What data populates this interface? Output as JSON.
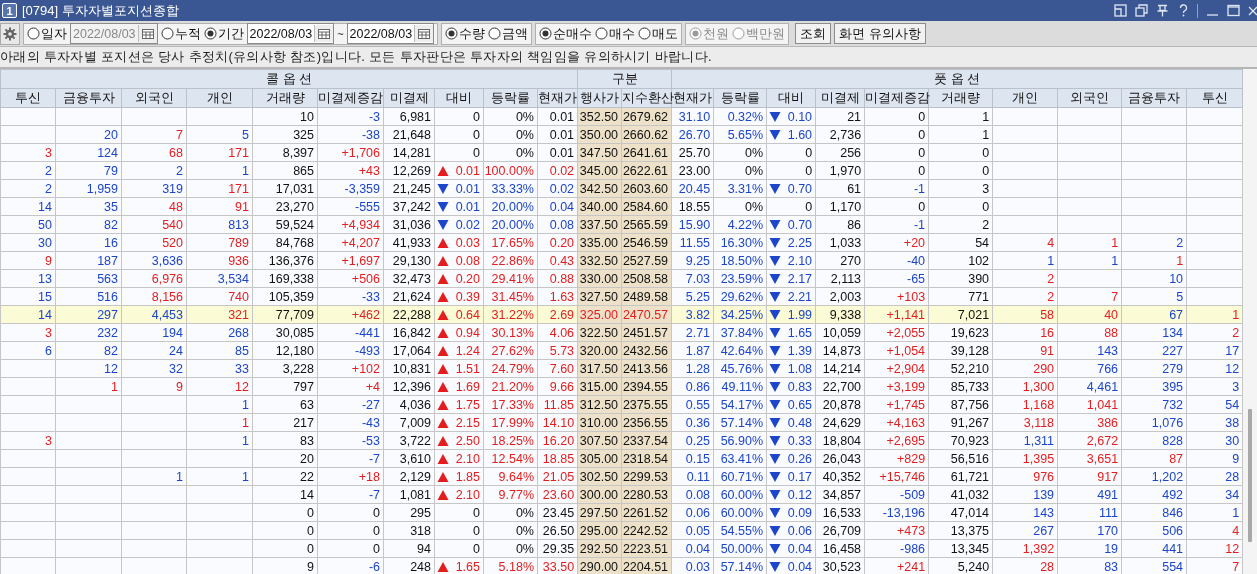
{
  "window": {
    "badge": "1",
    "title": "[0794] 투자자별포지션종합"
  },
  "toolbar": {
    "option_groups": [
      {
        "disabled": false,
        "items": [
          {
            "kind": "radio",
            "label": "일자",
            "selected": false
          },
          {
            "kind": "date",
            "value": "2022/08/03",
            "disabled": true
          },
          {
            "kind": "radio",
            "label": "누적",
            "selected": false
          },
          {
            "kind": "radio",
            "label": "기간",
            "selected": true
          },
          {
            "kind": "date",
            "value": "2022/08/03",
            "disabled": false
          },
          {
            "kind": "text",
            "label": "~"
          },
          {
            "kind": "date",
            "value": "2022/08/03",
            "disabled": false
          }
        ]
      },
      {
        "disabled": false,
        "items": [
          {
            "kind": "radio",
            "label": "수량",
            "selected": true
          },
          {
            "kind": "radio",
            "label": "금액",
            "selected": false
          }
        ]
      },
      {
        "disabled": false,
        "items": [
          {
            "kind": "radio",
            "label": "순매수",
            "selected": true
          },
          {
            "kind": "radio",
            "label": "매수",
            "selected": false
          },
          {
            "kind": "radio",
            "label": "매도",
            "selected": false
          }
        ]
      },
      {
        "disabled": true,
        "items": [
          {
            "kind": "radio",
            "label": "천원",
            "selected": true
          },
          {
            "kind": "radio",
            "label": "백만원",
            "selected": false
          }
        ]
      }
    ],
    "buttons": [
      "조회",
      "화면 유의사항"
    ]
  },
  "notice": "아래의 투자자별 포지션은 당사 추정치(유의사항 참조)입니다. 모든 투자판단은 투자자의 책임임을 유의하시기 바랍니다.",
  "table": {
    "column_groups": [
      {
        "kind": "call",
        "label": "콜 옵 션",
        "columns": [
          "투신",
          "금융투자",
          "외국인",
          "개인",
          "거래량",
          "미결제증감",
          "미결제",
          "대비",
          "등락률",
          "현재가"
        ]
      },
      {
        "kind": "strike",
        "label": "구분",
        "columns": [
          "행사가",
          "지수환산"
        ]
      },
      {
        "kind": "put",
        "label": "풋 옵 션",
        "columns": [
          "현재가",
          "등락률",
          "대비",
          "미결제",
          "미결제증감",
          "거래량",
          "개인",
          "외국인",
          "금융투자",
          "투신"
        ]
      }
    ],
    "rows": [
      {
        "highlighted": false,
        "cells": [
          null,
          null,
          null,
          null,
          "10",
          {
            "text": "-3",
            "color": "#1c45c9"
          },
          "6,981",
          "0",
          "0%",
          "0.01",
          "352.50",
          "2679.62",
          {
            "text": "31.10",
            "color": "#1c45c9"
          },
          {
            "text": "0.32%",
            "color": "#1c45c9"
          },
          {
            "text": "0.10",
            "color": "#1c45c9",
            "rising": false
          },
          "21",
          "0",
          "1",
          null,
          null,
          null,
          null
        ]
      },
      {
        "highlighted": false,
        "cells": [
          null,
          {
            "text": "20",
            "color": "#1c45c9"
          },
          {
            "text": "7",
            "color": "#e41e1e"
          },
          {
            "text": "5",
            "color": "#1c45c9"
          },
          "325",
          {
            "text": "-38",
            "color": "#1c45c9"
          },
          "21,648",
          "0",
          "0%",
          "0.01",
          "350.00",
          "2660.62",
          {
            "text": "26.70",
            "color": "#1c45c9"
          },
          {
            "text": "5.65%",
            "color": "#1c45c9"
          },
          {
            "text": "1.60",
            "color": "#1c45c9",
            "rising": false
          },
          "2,736",
          "0",
          "1",
          null,
          null,
          null,
          null
        ]
      },
      {
        "highlighted": false,
        "cells": [
          {
            "text": "3",
            "color": "#e41e1e"
          },
          {
            "text": "124",
            "color": "#1c45c9"
          },
          {
            "text": "68",
            "color": "#e41e1e"
          },
          {
            "text": "171",
            "color": "#e41e1e"
          },
          "8,397",
          {
            "text": "+1,706",
            "color": "#e41e1e"
          },
          "14,281",
          "0",
          "0%",
          "0.01",
          "347.50",
          "2641.61",
          "25.70",
          "0%",
          "0",
          "256",
          "0",
          "0",
          null,
          null,
          null,
          null
        ]
      },
      {
        "highlighted": false,
        "cells": [
          {
            "text": "2",
            "color": "#1c45c9"
          },
          {
            "text": "79",
            "color": "#1c45c9"
          },
          {
            "text": "2",
            "color": "#1c45c9"
          },
          {
            "text": "1",
            "color": "#1c45c9"
          },
          "865",
          {
            "text": "+43",
            "color": "#e41e1e"
          },
          "12,269",
          {
            "text": "0.01",
            "color": "#e41e1e",
            "rising": true
          },
          {
            "text": "100.00%",
            "color": "#e41e1e"
          },
          {
            "text": "0.02",
            "color": "#e41e1e"
          },
          "345.00",
          "2622.61",
          "23.00",
          "0%",
          "0",
          "1,970",
          "0",
          "0",
          null,
          null,
          null,
          null
        ]
      },
      {
        "highlighted": false,
        "cells": [
          {
            "text": "2",
            "color": "#1c45c9"
          },
          {
            "text": "1,959",
            "color": "#1c45c9"
          },
          {
            "text": "319",
            "color": "#1c45c9"
          },
          {
            "text": "171",
            "color": "#e41e1e"
          },
          "17,031",
          {
            "text": "-3,359",
            "color": "#1c45c9"
          },
          "21,245",
          {
            "text": "0.01",
            "color": "#1c45c9",
            "rising": false
          },
          {
            "text": "33.33%",
            "color": "#1c45c9"
          },
          {
            "text": "0.02",
            "color": "#1c45c9"
          },
          "342.50",
          "2603.60",
          {
            "text": "20.45",
            "color": "#1c45c9"
          },
          {
            "text": "3.31%",
            "color": "#1c45c9"
          },
          {
            "text": "0.70",
            "color": "#1c45c9",
            "rising": false
          },
          "61",
          {
            "text": "-1",
            "color": "#1c45c9"
          },
          "3",
          null,
          null,
          null,
          null
        ]
      },
      {
        "highlighted": false,
        "cells": [
          {
            "text": "14",
            "color": "#1c45c9"
          },
          {
            "text": "35",
            "color": "#1c45c9"
          },
          {
            "text": "48",
            "color": "#e41e1e"
          },
          {
            "text": "91",
            "color": "#e41e1e"
          },
          "23,270",
          {
            "text": "-555",
            "color": "#1c45c9"
          },
          "37,242",
          {
            "text": "0.01",
            "color": "#1c45c9",
            "rising": false
          },
          {
            "text": "20.00%",
            "color": "#1c45c9"
          },
          {
            "text": "0.04",
            "color": "#1c45c9"
          },
          "340.00",
          "2584.60",
          "18.55",
          "0%",
          "0",
          "1,170",
          "0",
          "0",
          null,
          null,
          null,
          null
        ]
      },
      {
        "highlighted": false,
        "cells": [
          {
            "text": "50",
            "color": "#1c45c9"
          },
          {
            "text": "82",
            "color": "#1c45c9"
          },
          {
            "text": "540",
            "color": "#e41e1e"
          },
          {
            "text": "813",
            "color": "#1c45c9"
          },
          "59,524",
          {
            "text": "+4,934",
            "color": "#e41e1e"
          },
          "31,036",
          {
            "text": "0.02",
            "color": "#1c45c9",
            "rising": false
          },
          {
            "text": "20.00%",
            "color": "#1c45c9"
          },
          {
            "text": "0.08",
            "color": "#1c45c9"
          },
          "337.50",
          "2565.59",
          {
            "text": "15.90",
            "color": "#1c45c9"
          },
          {
            "text": "4.22%",
            "color": "#1c45c9"
          },
          {
            "text": "0.70",
            "color": "#1c45c9",
            "rising": false
          },
          "86",
          {
            "text": "-1",
            "color": "#1c45c9"
          },
          "2",
          null,
          null,
          null,
          null
        ]
      },
      {
        "highlighted": false,
        "cells": [
          {
            "text": "30",
            "color": "#1c45c9"
          },
          {
            "text": "16",
            "color": "#1c45c9"
          },
          {
            "text": "520",
            "color": "#e41e1e"
          },
          {
            "text": "789",
            "color": "#e41e1e"
          },
          "84,768",
          {
            "text": "+4,207",
            "color": "#e41e1e"
          },
          "41,933",
          {
            "text": "0.03",
            "color": "#e41e1e",
            "rising": true
          },
          {
            "text": "17.65%",
            "color": "#e41e1e"
          },
          {
            "text": "0.20",
            "color": "#e41e1e"
          },
          "335.00",
          "2546.59",
          {
            "text": "11.55",
            "color": "#1c45c9"
          },
          {
            "text": "16.30%",
            "color": "#1c45c9"
          },
          {
            "text": "2.25",
            "color": "#1c45c9",
            "rising": false
          },
          "1,033",
          {
            "text": "+20",
            "color": "#e41e1e"
          },
          "54",
          {
            "text": "4",
            "color": "#e41e1e"
          },
          {
            "text": "1",
            "color": "#e41e1e"
          },
          {
            "text": "2",
            "color": "#1c45c9"
          },
          null
        ]
      },
      {
        "highlighted": false,
        "cells": [
          {
            "text": "9",
            "color": "#e41e1e"
          },
          {
            "text": "187",
            "color": "#1c45c9"
          },
          {
            "text": "3,636",
            "color": "#1c45c9"
          },
          {
            "text": "936",
            "color": "#e41e1e"
          },
          "136,376",
          {
            "text": "+1,697",
            "color": "#e41e1e"
          },
          "29,130",
          {
            "text": "0.08",
            "color": "#e41e1e",
            "rising": true
          },
          {
            "text": "22.86%",
            "color": "#e41e1e"
          },
          {
            "text": "0.43",
            "color": "#e41e1e"
          },
          "332.50",
          "2527.59",
          {
            "text": "9.25",
            "color": "#1c45c9"
          },
          {
            "text": "18.50%",
            "color": "#1c45c9"
          },
          {
            "text": "2.10",
            "color": "#1c45c9",
            "rising": false
          },
          "270",
          {
            "text": "-40",
            "color": "#1c45c9"
          },
          "102",
          {
            "text": "1",
            "color": "#1c45c9"
          },
          {
            "text": "1",
            "color": "#1c45c9"
          },
          {
            "text": "1",
            "color": "#e41e1e"
          },
          null
        ]
      },
      {
        "highlighted": false,
        "cells": [
          {
            "text": "13",
            "color": "#1c45c9"
          },
          {
            "text": "563",
            "color": "#1c45c9"
          },
          {
            "text": "6,976",
            "color": "#e41e1e"
          },
          {
            "text": "3,534",
            "color": "#1c45c9"
          },
          "169,338",
          {
            "text": "+506",
            "color": "#e41e1e"
          },
          "32,473",
          {
            "text": "0.20",
            "color": "#e41e1e",
            "rising": true
          },
          {
            "text": "29.41%",
            "color": "#e41e1e"
          },
          {
            "text": "0.88",
            "color": "#e41e1e"
          },
          "330.00",
          "2508.58",
          {
            "text": "7.03",
            "color": "#1c45c9"
          },
          {
            "text": "23.59%",
            "color": "#1c45c9"
          },
          {
            "text": "2.17",
            "color": "#1c45c9",
            "rising": false
          },
          "2,113",
          {
            "text": "-65",
            "color": "#1c45c9"
          },
          "390",
          {
            "text": "2",
            "color": "#e41e1e"
          },
          null,
          {
            "text": "10",
            "color": "#1c45c9"
          },
          null
        ]
      },
      {
        "highlighted": false,
        "cells": [
          {
            "text": "15",
            "color": "#1c45c9"
          },
          {
            "text": "516",
            "color": "#1c45c9"
          },
          {
            "text": "8,156",
            "color": "#e41e1e"
          },
          {
            "text": "740",
            "color": "#e41e1e"
          },
          "105,359",
          {
            "text": "-33",
            "color": "#1c45c9"
          },
          "21,624",
          {
            "text": "0.39",
            "color": "#e41e1e",
            "rising": true
          },
          {
            "text": "31.45%",
            "color": "#e41e1e"
          },
          {
            "text": "1.63",
            "color": "#e41e1e"
          },
          "327.50",
          "2489.58",
          {
            "text": "5.25",
            "color": "#1c45c9"
          },
          {
            "text": "29.62%",
            "color": "#1c45c9"
          },
          {
            "text": "2.21",
            "color": "#1c45c9",
            "rising": false
          },
          "2,003",
          {
            "text": "+103",
            "color": "#e41e1e"
          },
          "771",
          {
            "text": "2",
            "color": "#e41e1e"
          },
          {
            "text": "7",
            "color": "#e41e1e"
          },
          {
            "text": "5",
            "color": "#1c45c9"
          },
          null
        ]
      },
      {
        "highlighted": true,
        "cells": [
          {
            "text": "14",
            "color": "#1c45c9"
          },
          {
            "text": "297",
            "color": "#1c45c9"
          },
          {
            "text": "4,453",
            "color": "#1c45c9"
          },
          {
            "text": "321",
            "color": "#e41e1e"
          },
          "77,709",
          {
            "text": "+462",
            "color": "#e41e1e"
          },
          "22,288",
          {
            "text": "0.64",
            "color": "#e41e1e",
            "rising": true
          },
          {
            "text": "31.22%",
            "color": "#e41e1e"
          },
          {
            "text": "2.69",
            "color": "#e41e1e"
          },
          {
            "text": "325.00",
            "color": "#e41e1e"
          },
          {
            "text": "2470.57",
            "color": "#e41e1e"
          },
          {
            "text": "3.82",
            "color": "#1c45c9"
          },
          {
            "text": "34.25%",
            "color": "#1c45c9"
          },
          {
            "text": "1.99",
            "color": "#1c45c9",
            "rising": false
          },
          "9,338",
          {
            "text": "+1,141",
            "color": "#e41e1e"
          },
          "7,021",
          {
            "text": "58",
            "color": "#e41e1e"
          },
          {
            "text": "40",
            "color": "#e41e1e"
          },
          {
            "text": "67",
            "color": "#1c45c9"
          },
          {
            "text": "1",
            "color": "#e41e1e"
          }
        ]
      },
      {
        "highlighted": false,
        "cells": [
          {
            "text": "3",
            "color": "#e41e1e"
          },
          {
            "text": "232",
            "color": "#1c45c9"
          },
          {
            "text": "194",
            "color": "#1c45c9"
          },
          {
            "text": "268",
            "color": "#1c45c9"
          },
          "30,085",
          {
            "text": "-441",
            "color": "#1c45c9"
          },
          "16,842",
          {
            "text": "0.94",
            "color": "#e41e1e",
            "rising": true
          },
          {
            "text": "30.13%",
            "color": "#e41e1e"
          },
          {
            "text": "4.06",
            "color": "#e41e1e"
          },
          "322.50",
          "2451.57",
          {
            "text": "2.71",
            "color": "#1c45c9"
          },
          {
            "text": "37.84%",
            "color": "#1c45c9"
          },
          {
            "text": "1.65",
            "color": "#1c45c9",
            "rising": false
          },
          "10,059",
          {
            "text": "+2,055",
            "color": "#e41e1e"
          },
          "19,623",
          {
            "text": "16",
            "color": "#e41e1e"
          },
          {
            "text": "88",
            "color": "#e41e1e"
          },
          {
            "text": "134",
            "color": "#1c45c9"
          },
          {
            "text": "2",
            "color": "#e41e1e"
          }
        ]
      },
      {
        "highlighted": false,
        "cells": [
          {
            "text": "6",
            "color": "#1c45c9"
          },
          {
            "text": "82",
            "color": "#1c45c9"
          },
          {
            "text": "24",
            "color": "#1c45c9"
          },
          {
            "text": "85",
            "color": "#1c45c9"
          },
          "12,180",
          {
            "text": "-493",
            "color": "#1c45c9"
          },
          "17,064",
          {
            "text": "1.24",
            "color": "#e41e1e",
            "rising": true
          },
          {
            "text": "27.62%",
            "color": "#e41e1e"
          },
          {
            "text": "5.73",
            "color": "#e41e1e"
          },
          "320.00",
          "2432.56",
          {
            "text": "1.87",
            "color": "#1c45c9"
          },
          {
            "text": "42.64%",
            "color": "#1c45c9"
          },
          {
            "text": "1.39",
            "color": "#1c45c9",
            "rising": false
          },
          "14,873",
          {
            "text": "+1,054",
            "color": "#e41e1e"
          },
          "39,128",
          {
            "text": "91",
            "color": "#e41e1e"
          },
          {
            "text": "143",
            "color": "#1c45c9"
          },
          {
            "text": "227",
            "color": "#1c45c9"
          },
          {
            "text": "17",
            "color": "#1c45c9"
          }
        ]
      },
      {
        "highlighted": false,
        "cells": [
          null,
          {
            "text": "12",
            "color": "#1c45c9"
          },
          {
            "text": "32",
            "color": "#1c45c9"
          },
          {
            "text": "33",
            "color": "#1c45c9"
          },
          "3,228",
          {
            "text": "+102",
            "color": "#e41e1e"
          },
          "10,831",
          {
            "text": "1.51",
            "color": "#e41e1e",
            "rising": true
          },
          {
            "text": "24.79%",
            "color": "#e41e1e"
          },
          {
            "text": "7.60",
            "color": "#e41e1e"
          },
          "317.50",
          "2413.56",
          {
            "text": "1.28",
            "color": "#1c45c9"
          },
          {
            "text": "45.76%",
            "color": "#1c45c9"
          },
          {
            "text": "1.08",
            "color": "#1c45c9",
            "rising": false
          },
          "14,214",
          {
            "text": "+2,904",
            "color": "#e41e1e"
          },
          "52,210",
          {
            "text": "290",
            "color": "#e41e1e"
          },
          {
            "text": "766",
            "color": "#1c45c9"
          },
          {
            "text": "279",
            "color": "#1c45c9"
          },
          {
            "text": "12",
            "color": "#1c45c9"
          }
        ]
      },
      {
        "highlighted": false,
        "cells": [
          null,
          {
            "text": "1",
            "color": "#e41e1e"
          },
          {
            "text": "9",
            "color": "#e41e1e"
          },
          {
            "text": "12",
            "color": "#e41e1e"
          },
          "797",
          {
            "text": "+4",
            "color": "#e41e1e"
          },
          "12,396",
          {
            "text": "1.69",
            "color": "#e41e1e",
            "rising": true
          },
          {
            "text": "21.20%",
            "color": "#e41e1e"
          },
          {
            "text": "9.66",
            "color": "#e41e1e"
          },
          "315.00",
          "2394.55",
          {
            "text": "0.86",
            "color": "#1c45c9"
          },
          {
            "text": "49.11%",
            "color": "#1c45c9"
          },
          {
            "text": "0.83",
            "color": "#1c45c9",
            "rising": false
          },
          "22,700",
          {
            "text": "+3,199",
            "color": "#e41e1e"
          },
          "85,733",
          {
            "text": "1,300",
            "color": "#e41e1e"
          },
          {
            "text": "4,461",
            "color": "#1c45c9"
          },
          {
            "text": "395",
            "color": "#1c45c9"
          },
          {
            "text": "3",
            "color": "#1c45c9"
          }
        ]
      },
      {
        "highlighted": false,
        "cells": [
          null,
          null,
          null,
          {
            "text": "1",
            "color": "#1c45c9"
          },
          "63",
          {
            "text": "-27",
            "color": "#1c45c9"
          },
          "4,036",
          {
            "text": "1.75",
            "color": "#e41e1e",
            "rising": true
          },
          {
            "text": "17.33%",
            "color": "#e41e1e"
          },
          {
            "text": "11.85",
            "color": "#e41e1e"
          },
          "312.50",
          "2375.55",
          {
            "text": "0.55",
            "color": "#1c45c9"
          },
          {
            "text": "54.17%",
            "color": "#1c45c9"
          },
          {
            "text": "0.65",
            "color": "#1c45c9",
            "rising": false
          },
          "20,878",
          {
            "text": "+1,745",
            "color": "#e41e1e"
          },
          "87,756",
          {
            "text": "1,168",
            "color": "#e41e1e"
          },
          {
            "text": "1,041",
            "color": "#e41e1e"
          },
          {
            "text": "732",
            "color": "#1c45c9"
          },
          {
            "text": "54",
            "color": "#1c45c9"
          }
        ]
      },
      {
        "highlighted": false,
        "cells": [
          null,
          null,
          null,
          {
            "text": "1",
            "color": "#e41e1e"
          },
          "217",
          {
            "text": "-43",
            "color": "#1c45c9"
          },
          "7,009",
          {
            "text": "2.15",
            "color": "#e41e1e",
            "rising": true
          },
          {
            "text": "17.99%",
            "color": "#e41e1e"
          },
          {
            "text": "14.10",
            "color": "#e41e1e"
          },
          "310.00",
          "2356.55",
          {
            "text": "0.36",
            "color": "#1c45c9"
          },
          {
            "text": "57.14%",
            "color": "#1c45c9"
          },
          {
            "text": "0.48",
            "color": "#1c45c9",
            "rising": false
          },
          "24,629",
          {
            "text": "+4,163",
            "color": "#e41e1e"
          },
          "91,267",
          {
            "text": "3,118",
            "color": "#e41e1e"
          },
          {
            "text": "386",
            "color": "#e41e1e"
          },
          {
            "text": "1,076",
            "color": "#1c45c9"
          },
          {
            "text": "38",
            "color": "#1c45c9"
          }
        ]
      },
      {
        "highlighted": false,
        "cells": [
          {
            "text": "3",
            "color": "#e41e1e"
          },
          null,
          null,
          {
            "text": "1",
            "color": "#1c45c9"
          },
          "83",
          {
            "text": "-53",
            "color": "#1c45c9"
          },
          "3,722",
          {
            "text": "2.50",
            "color": "#e41e1e",
            "rising": true
          },
          {
            "text": "18.25%",
            "color": "#e41e1e"
          },
          {
            "text": "16.20",
            "color": "#e41e1e"
          },
          "307.50",
          "2337.54",
          {
            "text": "0.25",
            "color": "#1c45c9"
          },
          {
            "text": "56.90%",
            "color": "#1c45c9"
          },
          {
            "text": "0.33",
            "color": "#1c45c9",
            "rising": false
          },
          "18,804",
          {
            "text": "+2,695",
            "color": "#e41e1e"
          },
          "70,923",
          {
            "text": "1,311",
            "color": "#1c45c9"
          },
          {
            "text": "2,672",
            "color": "#e41e1e"
          },
          {
            "text": "828",
            "color": "#1c45c9"
          },
          {
            "text": "30",
            "color": "#1c45c9"
          }
        ]
      },
      {
        "highlighted": false,
        "cells": [
          null,
          null,
          null,
          null,
          "20",
          {
            "text": "-7",
            "color": "#1c45c9"
          },
          "3,610",
          {
            "text": "2.10",
            "color": "#e41e1e",
            "rising": true
          },
          {
            "text": "12.54%",
            "color": "#e41e1e"
          },
          {
            "text": "18.85",
            "color": "#e41e1e"
          },
          "305.00",
          "2318.54",
          {
            "text": "0.15",
            "color": "#1c45c9"
          },
          {
            "text": "63.41%",
            "color": "#1c45c9"
          },
          {
            "text": "0.26",
            "color": "#1c45c9",
            "rising": false
          },
          "26,043",
          {
            "text": "+829",
            "color": "#e41e1e"
          },
          "56,516",
          {
            "text": "1,395",
            "color": "#e41e1e"
          },
          {
            "text": "3,651",
            "color": "#e41e1e"
          },
          {
            "text": "87",
            "color": "#e41e1e"
          },
          {
            "text": "9",
            "color": "#1c45c9"
          }
        ]
      },
      {
        "highlighted": false,
        "cells": [
          null,
          null,
          {
            "text": "1",
            "color": "#1c45c9"
          },
          {
            "text": "1",
            "color": "#1c45c9"
          },
          "22",
          {
            "text": "+18",
            "color": "#e41e1e"
          },
          "2,129",
          {
            "text": "1.85",
            "color": "#e41e1e",
            "rising": true
          },
          {
            "text": "9.64%",
            "color": "#e41e1e"
          },
          {
            "text": "21.05",
            "color": "#e41e1e"
          },
          "302.50",
          "2299.53",
          {
            "text": "0.11",
            "color": "#1c45c9"
          },
          {
            "text": "60.71%",
            "color": "#1c45c9"
          },
          {
            "text": "0.17",
            "color": "#1c45c9",
            "rising": false
          },
          "40,352",
          {
            "text": "+15,746",
            "color": "#e41e1e"
          },
          "61,721",
          {
            "text": "976",
            "color": "#e41e1e"
          },
          {
            "text": "917",
            "color": "#e41e1e"
          },
          {
            "text": "1,202",
            "color": "#1c45c9"
          },
          {
            "text": "28",
            "color": "#1c45c9"
          }
        ]
      },
      {
        "highlighted": false,
        "cells": [
          null,
          null,
          null,
          null,
          "14",
          {
            "text": "-7",
            "color": "#1c45c9"
          },
          "1,081",
          {
            "text": "2.10",
            "color": "#e41e1e",
            "rising": true
          },
          {
            "text": "9.77%",
            "color": "#e41e1e"
          },
          {
            "text": "23.60",
            "color": "#e41e1e"
          },
          "300.00",
          "2280.53",
          {
            "text": "0.08",
            "color": "#1c45c9"
          },
          {
            "text": "60.00%",
            "color": "#1c45c9"
          },
          {
            "text": "0.12",
            "color": "#1c45c9",
            "rising": false
          },
          "34,857",
          {
            "text": "-509",
            "color": "#1c45c9"
          },
          "41,032",
          {
            "text": "139",
            "color": "#1c45c9"
          },
          {
            "text": "491",
            "color": "#1c45c9"
          },
          {
            "text": "492",
            "color": "#1c45c9"
          },
          {
            "text": "34",
            "color": "#1c45c9"
          }
        ]
      },
      {
        "highlighted": false,
        "cells": [
          null,
          null,
          null,
          null,
          "0",
          "0",
          "295",
          "0",
          "0%",
          "23.45",
          "297.50",
          "2261.52",
          {
            "text": "0.06",
            "color": "#1c45c9"
          },
          {
            "text": "60.00%",
            "color": "#1c45c9"
          },
          {
            "text": "0.09",
            "color": "#1c45c9",
            "rising": false
          },
          "16,533",
          {
            "text": "-13,196",
            "color": "#1c45c9"
          },
          "47,014",
          {
            "text": "143",
            "color": "#1c45c9"
          },
          {
            "text": "111",
            "color": "#1c45c9"
          },
          {
            "text": "846",
            "color": "#1c45c9"
          },
          {
            "text": "1",
            "color": "#1c45c9"
          }
        ]
      },
      {
        "highlighted": false,
        "cells": [
          null,
          null,
          null,
          null,
          "0",
          "0",
          "318",
          "0",
          "0%",
          "26.50",
          "295.00",
          "2242.52",
          {
            "text": "0.05",
            "color": "#1c45c9"
          },
          {
            "text": "54.55%",
            "color": "#1c45c9"
          },
          {
            "text": "0.06",
            "color": "#1c45c9",
            "rising": false
          },
          "26,709",
          {
            "text": "+473",
            "color": "#e41e1e"
          },
          "13,375",
          {
            "text": "267",
            "color": "#1c45c9"
          },
          {
            "text": "170",
            "color": "#1c45c9"
          },
          {
            "text": "506",
            "color": "#1c45c9"
          },
          {
            "text": "4",
            "color": "#e41e1e"
          }
        ]
      },
      {
        "highlighted": false,
        "cells": [
          null,
          null,
          null,
          null,
          "0",
          "0",
          "94",
          "0",
          "0%",
          "29.35",
          "292.50",
          "2223.51",
          {
            "text": "0.04",
            "color": "#1c45c9"
          },
          {
            "text": "50.00%",
            "color": "#1c45c9"
          },
          {
            "text": "0.04",
            "color": "#1c45c9",
            "rising": false
          },
          "16,458",
          {
            "text": "-986",
            "color": "#1c45c9"
          },
          "13,345",
          {
            "text": "1,392",
            "color": "#e41e1e"
          },
          {
            "text": "19",
            "color": "#1c45c9"
          },
          {
            "text": "441",
            "color": "#1c45c9"
          },
          {
            "text": "12",
            "color": "#e41e1e"
          }
        ]
      },
      {
        "highlighted": false,
        "cells": [
          null,
          null,
          null,
          null,
          "9",
          {
            "text": "-6",
            "color": "#1c45c9"
          },
          "248",
          {
            "text": "1.65",
            "color": "#e41e1e",
            "rising": true
          },
          {
            "text": "5.18%",
            "color": "#e41e1e"
          },
          {
            "text": "33.50",
            "color": "#e41e1e"
          },
          "290.00",
          "2204.51",
          {
            "text": "0.03",
            "color": "#1c45c9"
          },
          {
            "text": "57.14%",
            "color": "#1c45c9"
          },
          {
            "text": "0.04",
            "color": "#1c45c9",
            "rising": false
          },
          "30,523",
          {
            "text": "+241",
            "color": "#e41e1e"
          },
          "5,240",
          {
            "text": "28",
            "color": "#e41e1e"
          },
          {
            "text": "83",
            "color": "#1c45c9"
          },
          {
            "text": "554",
            "color": "#1c45c9"
          },
          {
            "text": "7",
            "color": "#e41e1e"
          }
        ]
      }
    ]
  }
}
